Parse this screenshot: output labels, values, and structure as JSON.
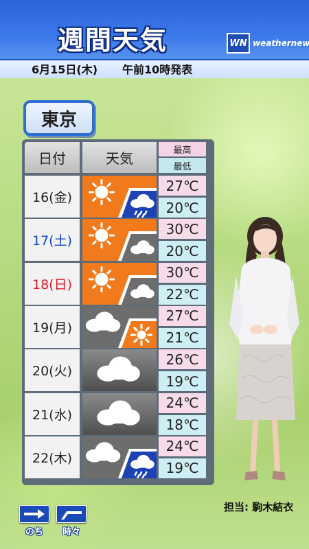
{
  "header": {
    "title": "週間天気",
    "date": "6月15日(木)",
    "issued": "午前10時発表",
    "logo_mark": "WN",
    "logo_text": "weathernews"
  },
  "city": "東京",
  "table": {
    "col_date": "日付",
    "col_weather": "天気",
    "col_high": "最高",
    "col_low": "最低",
    "rows": [
      {
        "date": "16(金)",
        "weather": [
          "sunny-icon",
          "rain-icon"
        ],
        "high": "27℃",
        "low": "20℃"
      },
      {
        "date": "17(土)",
        "weather": [
          "sunny-icon",
          "cloudy-icon"
        ],
        "high": "30℃",
        "low": "20℃"
      },
      {
        "date": "18(日)",
        "weather": [
          "sunny-icon",
          "cloudy-icon"
        ],
        "high": "30℃",
        "low": "22℃"
      },
      {
        "date": "19(月)",
        "weather": [
          "cloudy-icon",
          "sunny-icon"
        ],
        "high": "27℃",
        "low": "21℃"
      },
      {
        "date": "20(火)",
        "weather": [
          "cloudy-icon"
        ],
        "high": "26℃",
        "low": "19℃"
      },
      {
        "date": "21(水)",
        "weather": [
          "cloudy-icon"
        ],
        "high": "24℃",
        "low": "18℃"
      },
      {
        "date": "22(木)",
        "weather": [
          "cloudy-icon",
          "rain-icon"
        ],
        "high": "24℃",
        "low": "19℃"
      }
    ]
  },
  "presenter_credit": "担当: 駒木結衣",
  "nav": {
    "next_label": "のち",
    "sometimes_label": "時々"
  },
  "colors": {
    "sunny_bg": "#f07a1c",
    "cloudy_bg": "#6d6d6d",
    "rain_bg": "#1d42b4",
    "saturday": "#1747c8",
    "sunday": "#e0182d"
  }
}
